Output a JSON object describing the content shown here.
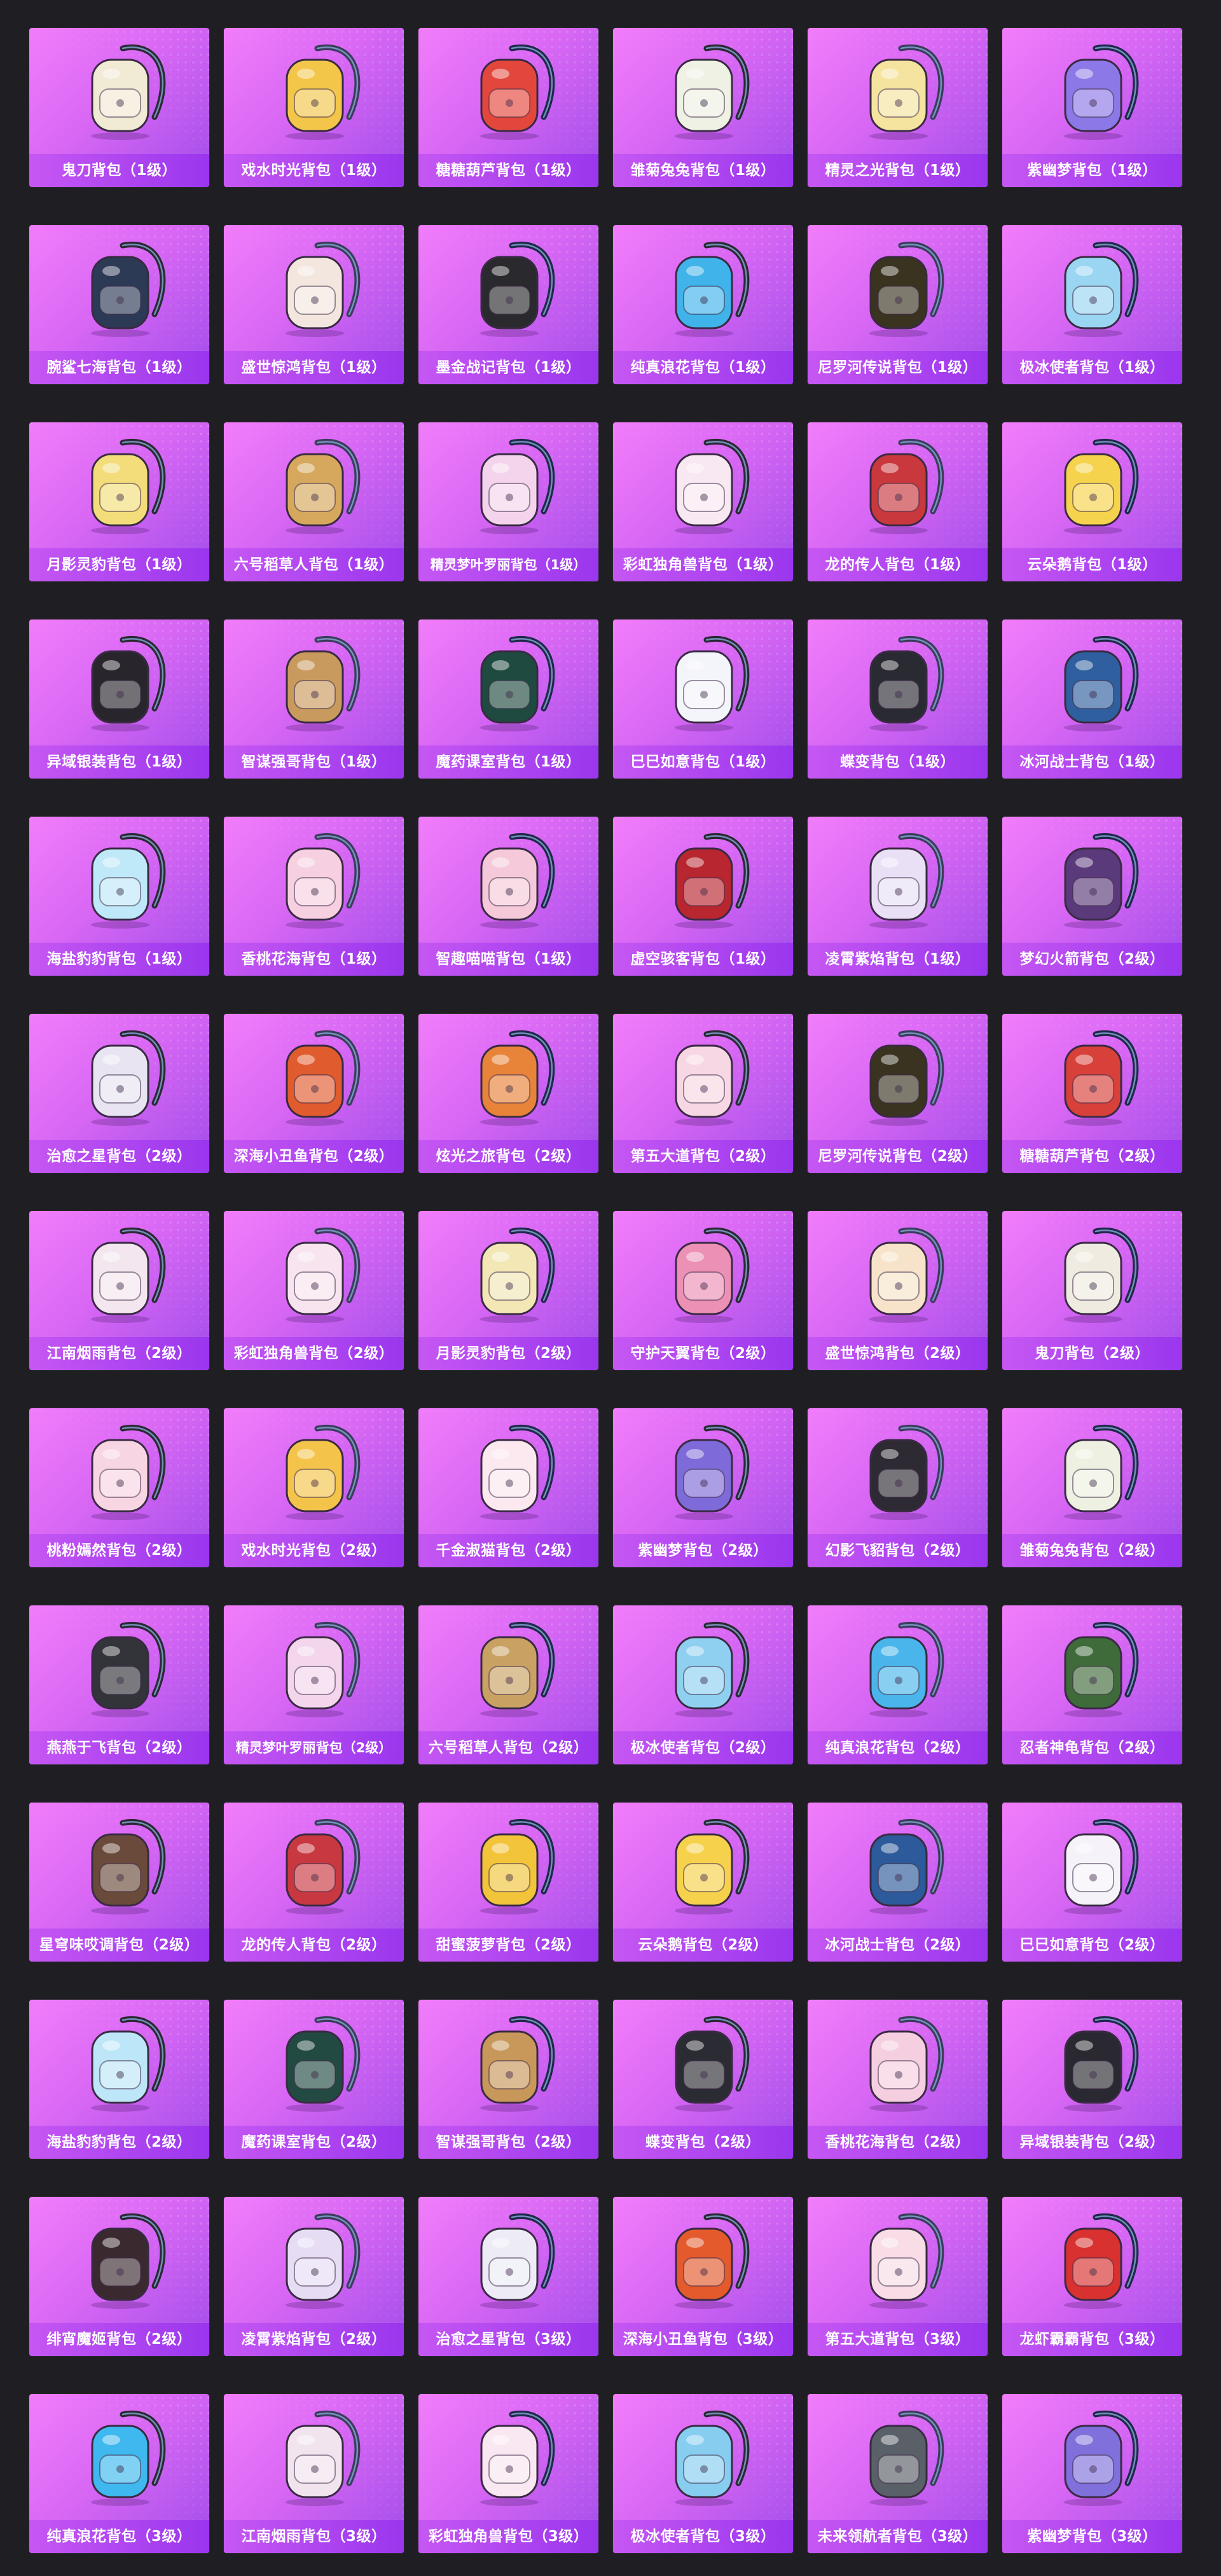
{
  "items": [
    {
      "name": "鬼刀背包（1级）",
      "color": "#f1ead5"
    },
    {
      "name": "戏水时光背包（1级）",
      "color": "#f3c64a"
    },
    {
      "name": "糖糖葫芦背包（1级）",
      "color": "#e3473b"
    },
    {
      "name": "雏菊兔兔背包（1级）",
      "color": "#eef1e3"
    },
    {
      "name": "精灵之光背包（1级）",
      "color": "#f5e3a0"
    },
    {
      "name": "紫幽梦背包（1级）",
      "color": "#8c78e6"
    },
    {
      "name": "腕鲨七海背包（1级）",
      "color": "#2c3a56"
    },
    {
      "name": "盛世惊鸿背包（1级）",
      "color": "#f3e6df"
    },
    {
      "name": "墨金战记背包（1级）",
      "color": "#2a2a2e"
    },
    {
      "name": "纯真浪花背包（1级）",
      "color": "#3fb3ea"
    },
    {
      "name": "尼罗河传说背包（1级）",
      "color": "#3a3320"
    },
    {
      "name": "极冰使者背包（1级）",
      "color": "#9ad5f2"
    },
    {
      "name": "月影灵豹背包（1级）",
      "color": "#f3dd7a"
    },
    {
      "name": "六号稻草人背包（1级）",
      "color": "#d6a85d"
    },
    {
      "name": "精灵梦叶罗丽背包（1级）",
      "color": "#f4d4ec"
    },
    {
      "name": "彩虹独角兽背包（1级）",
      "color": "#f8e8f2"
    },
    {
      "name": "龙的传人背包（1级）",
      "color": "#c8383d"
    },
    {
      "name": "云朵鹅背包（1级）",
      "color": "#f6d34c"
    },
    {
      "name": "异域银装背包（1级）",
      "color": "#28262c"
    },
    {
      "name": "智谋强哥背包（1级）",
      "color": "#c99a5e"
    },
    {
      "name": "魔药课室背包（1级）",
      "color": "#1f4a40"
    },
    {
      "name": "巳巳如意背包（1级）",
      "color": "#f4f4fb"
    },
    {
      "name": "蝶变背包（1级）",
      "color": "#2a2a33"
    },
    {
      "name": "冰河战士背包（1级）",
      "color": "#2f5f9e"
    },
    {
      "name": "海盐豹豹背包（1级）",
      "color": "#bfe8f8"
    },
    {
      "name": "香桃花海背包（1级）",
      "color": "#f6cfe0"
    },
    {
      "name": "智趣喵喵背包（1级）",
      "color": "#f5c9d9"
    },
    {
      "name": "虚空骇客背包（1级）",
      "color": "#b8262f"
    },
    {
      "name": "凌霄紫焰背包（1级）",
      "color": "#e9e0f5"
    },
    {
      "name": "梦幻火箭背包（2级）",
      "color": "#5a3a7a"
    },
    {
      "name": "治愈之星背包（2级）",
      "color": "#e8e4f2"
    },
    {
      "name": "深海小丑鱼背包（2级）",
      "color": "#e05b2e"
    },
    {
      "name": "炫光之旅背包（2级）",
      "color": "#e8833a"
    },
    {
      "name": "第五大道背包（2级）",
      "color": "#f7d7e3"
    },
    {
      "name": "尼罗河传说背包（2级）",
      "color": "#3a3320"
    },
    {
      "name": "糖糖葫芦背包（2级）",
      "color": "#d8403a"
    },
    {
      "name": "江南烟雨背包（2级）",
      "color": "#f3e6ee"
    },
    {
      "name": "彩虹独角兽背包（2级）",
      "color": "#f8e4ef"
    },
    {
      "name": "月影灵豹背包（2级）",
      "color": "#f2e7b5"
    },
    {
      "name": "守护天翼背包（2级）",
      "color": "#ec90b5"
    },
    {
      "name": "盛世惊鸿背包（2级）",
      "color": "#f6e3c9"
    },
    {
      "name": "鬼刀背包（2级）",
      "color": "#f0ebe1"
    },
    {
      "name": "桃粉嫣然背包（2级）",
      "color": "#f8d5e2"
    },
    {
      "name": "戏水时光背包（2级）",
      "color": "#f4c44a"
    },
    {
      "name": "千金淑猫背包（2级）",
      "color": "#fbe9ef"
    },
    {
      "name": "紫幽梦背包（2级）",
      "color": "#7e6ad8"
    },
    {
      "name": "幻影飞貂背包（2级）",
      "color": "#2e2a33"
    },
    {
      "name": "雏菊兔兔背包（2级）",
      "color": "#eef1e2"
    },
    {
      "name": "燕燕于飞背包（2级）",
      "color": "#33333a"
    },
    {
      "name": "精灵梦叶罗丽背包（2级）",
      "color": "#f3d5ec"
    },
    {
      "name": "六号稻草人背包（2级）",
      "color": "#c9a163"
    },
    {
      "name": "极冰使者背包（2级）",
      "color": "#8fd0f1"
    },
    {
      "name": "纯真浪花背包（2级）",
      "color": "#4ab5ea"
    },
    {
      "name": "忍者神龟背包（2级）",
      "color": "#3f6b3a"
    },
    {
      "name": "星穹味哎调背包（2级）",
      "color": "#6a4a3a"
    },
    {
      "name": "龙的传人背包（2级）",
      "color": "#c83840"
    },
    {
      "name": "甜蜜菠萝背包（2级）",
      "color": "#f2c43a"
    },
    {
      "name": "云朵鹅背包（2级）",
      "color": "#f6d24c"
    },
    {
      "name": "冰河战士背包（2级）",
      "color": "#2c5a9a"
    },
    {
      "name": "巳巳如意背包（2级）",
      "color": "#f6f2fa"
    },
    {
      "name": "海盐豹豹背包（2级）",
      "color": "#bde6f8"
    },
    {
      "name": "魔药课室背包（2级）",
      "color": "#234a42"
    },
    {
      "name": "智谋强哥背包（2级）",
      "color": "#c8975a"
    },
    {
      "name": "蝶变背包（2级）",
      "color": "#2b2b33"
    },
    {
      "name": "香桃花海背包（2级）",
      "color": "#f5cedf"
    },
    {
      "name": "异域银装背包（2级）",
      "color": "#2a2830"
    },
    {
      "name": "绯宵魔姬背包（2级）",
      "color": "#3a2a30"
    },
    {
      "name": "凌霄紫焰背包（2级）",
      "color": "#e6dcf4"
    },
    {
      "name": "治愈之星背包（3级）",
      "color": "#ecebf6"
    },
    {
      "name": "深海小丑鱼背包（3级）",
      "color": "#e45a2c"
    },
    {
      "name": "第五大道背包（3级）",
      "color": "#f8dce6"
    },
    {
      "name": "龙虾霸霸背包（3级）",
      "color": "#d8312f"
    },
    {
      "name": "纯真浪花背包（3级）",
      "color": "#3eb8ee"
    },
    {
      "name": "江南烟雨背包（3级）",
      "color": "#f1e4ee"
    },
    {
      "name": "彩虹独角兽背包（3级）",
      "color": "#f9e7f1"
    },
    {
      "name": "极冰使者背包（3级）",
      "color": "#86cdf0"
    },
    {
      "name": "未来领航者背包（3级）",
      "color": "#5a6068"
    },
    {
      "name": "紫幽梦背包（3级）",
      "color": "#8070dc"
    }
  ]
}
